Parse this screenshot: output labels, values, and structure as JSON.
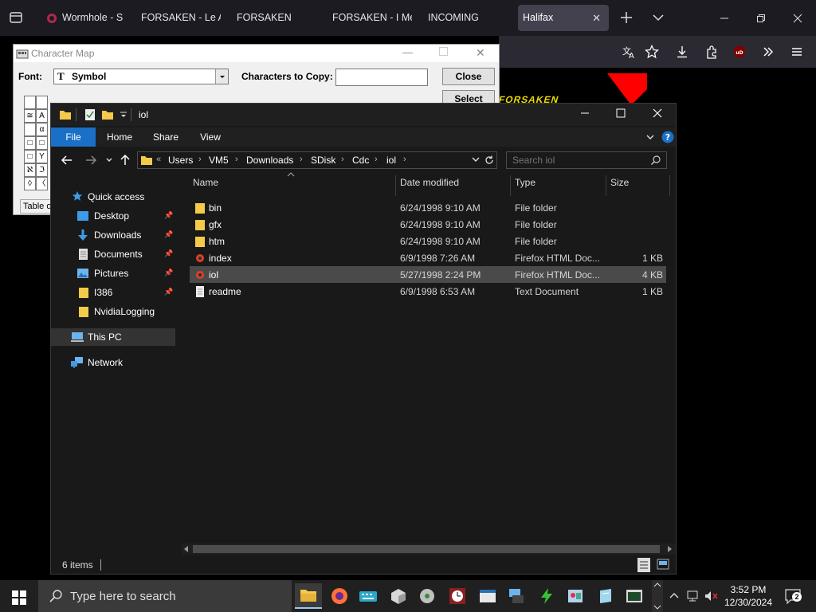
{
  "browser": {
    "tabs": [
      {
        "label": "Wormhole - S",
        "active": false
      },
      {
        "label": "FORSAKEN - Le A",
        "active": false
      },
      {
        "label": "FORSAKEN",
        "active": false
      },
      {
        "label": "FORSAKEN - I Me",
        "active": false
      },
      {
        "label": "INCOMING",
        "active": false
      },
      {
        "label": "Halifax",
        "active": true
      }
    ],
    "extension_badge": "uD"
  },
  "background_page": {
    "logo_text": "FORSAKEN",
    "accent_red": "#ff0000",
    "logo_yellow": "#e9d900"
  },
  "charmap": {
    "title": "Character Map",
    "font_label": "Font:",
    "font_value": "Symbol",
    "chars_label": "Characters to Copy:",
    "chars_value": "",
    "close_button": "Close",
    "select_button": "Select",
    "grid_col1": [
      "≅",
      "",
      "□",
      "□",
      "ℵ",
      "◊"
    ],
    "grid_col2": [
      "A",
      "α",
      "□",
      "Υ",
      "ℑ",
      "〈"
    ],
    "status": "Table o"
  },
  "explorer": {
    "title": "iol",
    "ribbon_tabs": [
      "File",
      "Home",
      "Share",
      "View"
    ],
    "breadcrumb": [
      "Users",
      "VM5",
      "Downloads",
      "SDisk",
      "Cdc",
      "iol"
    ],
    "breadcrumb_overflow": "«",
    "search_placeholder": "Search iol",
    "nav": {
      "quick_access": "Quick access",
      "items": [
        "Desktop",
        "Downloads",
        "Documents",
        "Pictures",
        "I386",
        "NvidiaLogging"
      ],
      "this_pc": "This PC",
      "network": "Network"
    },
    "columns": {
      "name": "Name",
      "date": "Date modified",
      "type": "Type",
      "size": "Size"
    },
    "files": [
      {
        "name": "bin",
        "date": "6/24/1998 9:10 AM",
        "type": "File folder",
        "size": "",
        "icon": "folder-icon"
      },
      {
        "name": "gfx",
        "date": "6/24/1998 9:10 AM",
        "type": "File folder",
        "size": "",
        "icon": "folder-icon"
      },
      {
        "name": "htm",
        "date": "6/24/1998 9:10 AM",
        "type": "File folder",
        "size": "",
        "icon": "folder-icon"
      },
      {
        "name": "index",
        "date": "6/9/1998 7:26 AM",
        "type": "Firefox HTML Doc...",
        "size": "1 KB",
        "icon": "html-file-icon"
      },
      {
        "name": "iol",
        "date": "5/27/1998 2:24 PM",
        "type": "Firefox HTML Doc...",
        "size": "4 KB",
        "icon": "html-file-icon",
        "selected": true
      },
      {
        "name": "readme",
        "date": "6/9/1998 6:53 AM",
        "type": "Text Document",
        "size": "1 KB",
        "icon": "text-file-icon"
      }
    ],
    "status": "6 items"
  },
  "taskbar": {
    "search_placeholder": "Type here to search",
    "time": "3:52 PM",
    "date": "12/30/2024",
    "notifications": "2"
  },
  "colors": {
    "explorer_bg": "#191919",
    "file_tab": "#1a6fc6",
    "folder": "#f5c94a",
    "selection": "#4a4a4a"
  }
}
